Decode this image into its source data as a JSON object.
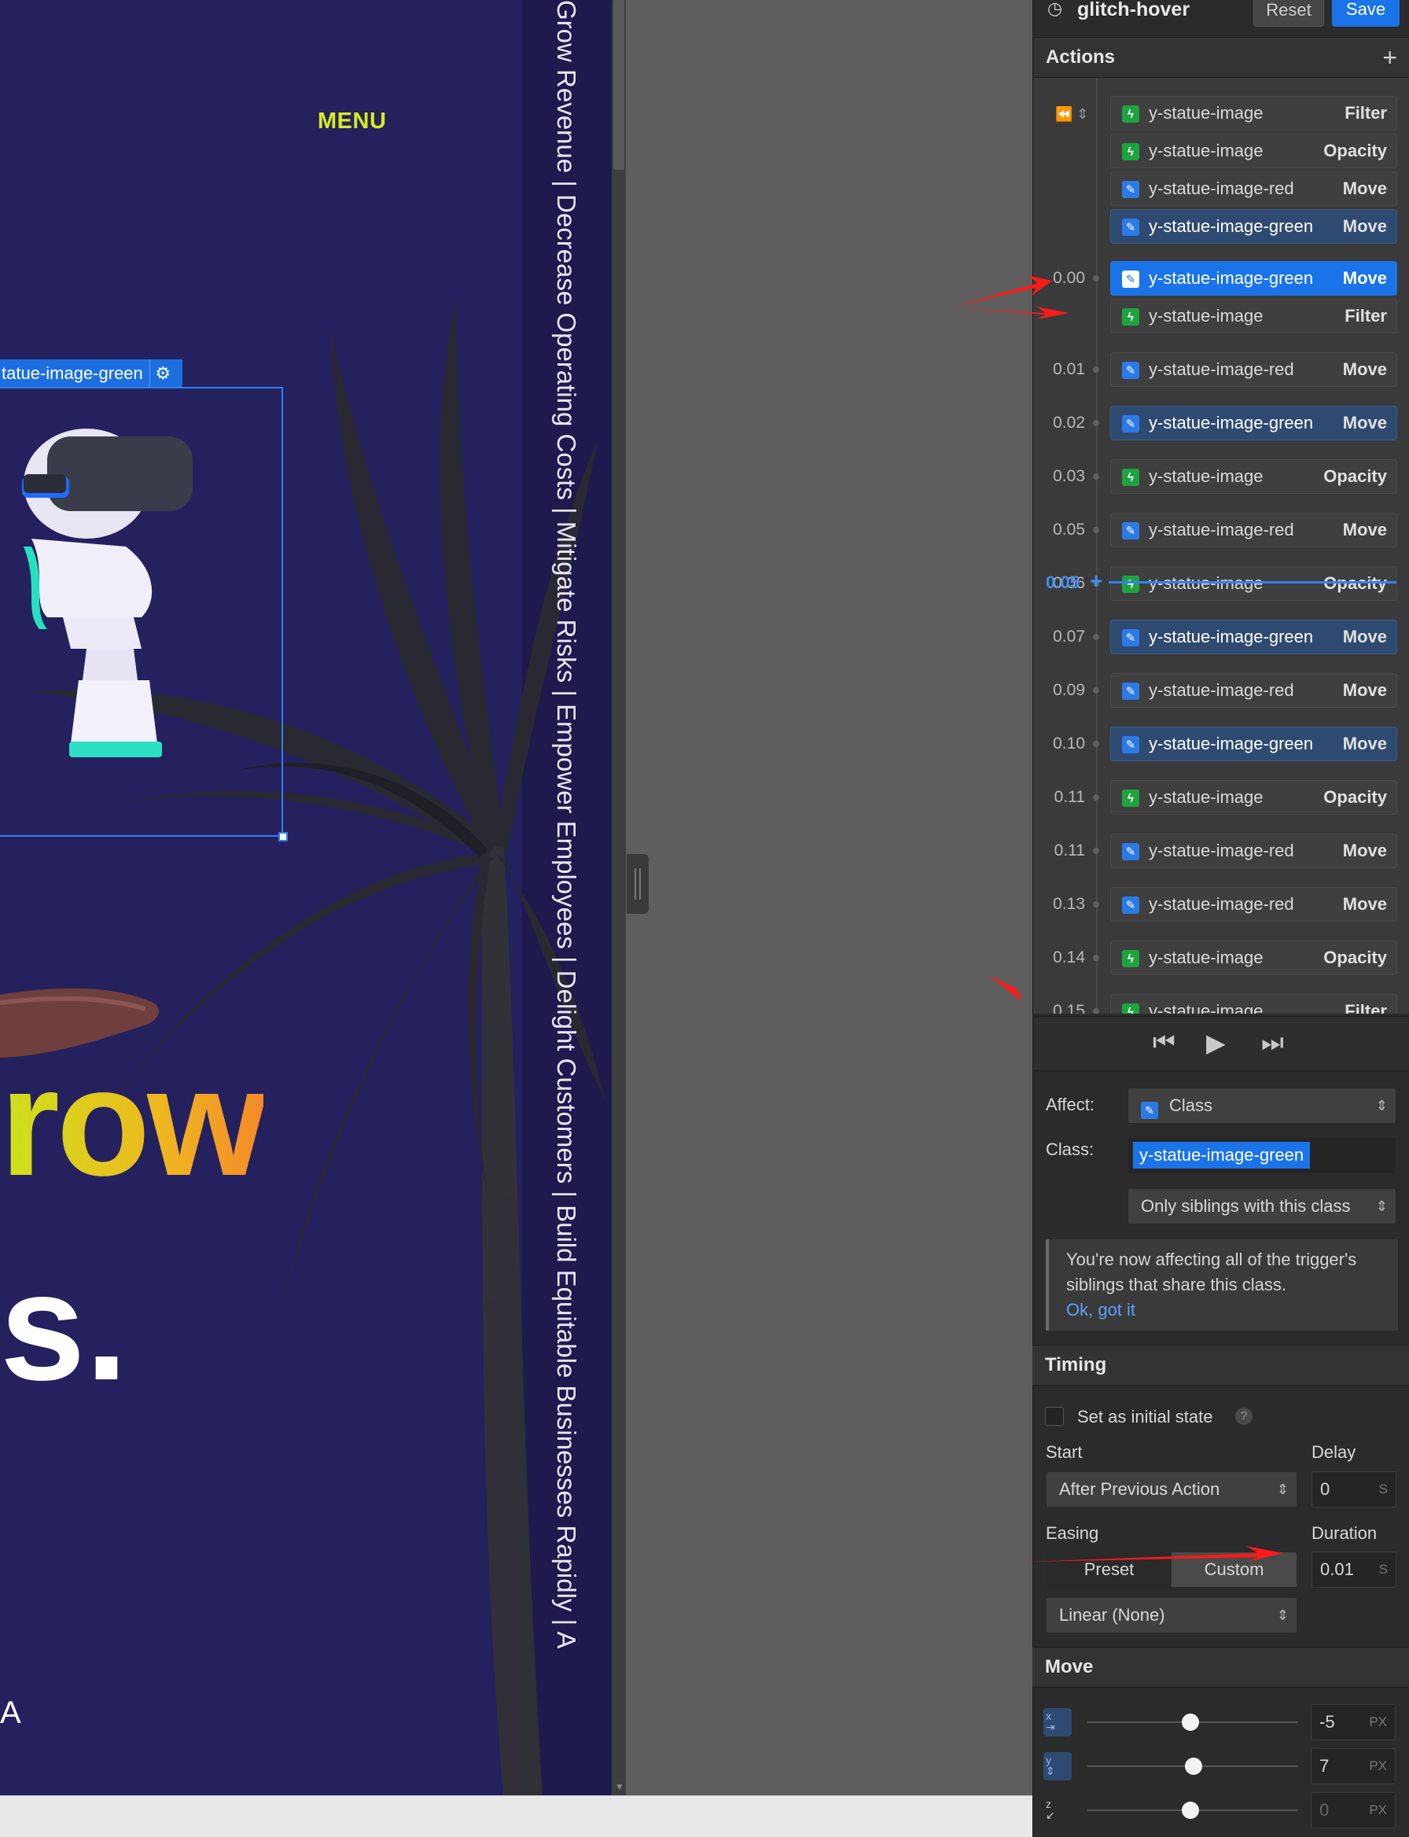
{
  "canvas": {
    "menu_label": "MENU",
    "vertical_text": "Grow Revenue  |  Decrease Operating Costs  |  Mitigate Risks  |  Empower Employees  |  Delight Customers  |  Build Equitable Businesses Rapidly  |  A",
    "selected_element_tag": "tatue-image-green",
    "headline_line1": "row",
    "headline_line2": "s.",
    "bottom_letter": "A"
  },
  "panel": {
    "interaction_name": "glitch-hover",
    "reset_label": "Reset",
    "save_label": "Save",
    "actions_title": "Actions",
    "playhead_time": "0.05",
    "actions": [
      {
        "time": "",
        "icon": "green",
        "target": "y-statue-image",
        "kind": "Filter"
      },
      {
        "time": "",
        "icon": "green",
        "target": "y-statue-image",
        "kind": "Opacity"
      },
      {
        "time": "",
        "icon": "blue",
        "target": "y-statue-image-red",
        "kind": "Move"
      },
      {
        "time": "",
        "icon": "blue",
        "target": "y-statue-image-green",
        "kind": "Move"
      },
      {
        "time": "0.00",
        "icon": "blue",
        "target": "y-statue-image-green",
        "kind": "Move"
      },
      {
        "time": "",
        "icon": "green",
        "target": "y-statue-image",
        "kind": "Filter"
      },
      {
        "time": "0.01",
        "icon": "blue",
        "target": "y-statue-image-red",
        "kind": "Move"
      },
      {
        "time": "0.02",
        "icon": "blue",
        "target": "y-statue-image-green",
        "kind": "Move"
      },
      {
        "time": "0.03",
        "icon": "green",
        "target": "y-statue-image",
        "kind": "Opacity"
      },
      {
        "time": "0.05",
        "icon": "blue",
        "target": "y-statue-image-red",
        "kind": "Move"
      },
      {
        "time": "0.06",
        "icon": "green",
        "target": "y-statue-image",
        "kind": "Opacity"
      },
      {
        "time": "0.07",
        "icon": "blue",
        "target": "y-statue-image-green",
        "kind": "Move"
      },
      {
        "time": "0.09",
        "icon": "blue",
        "target": "y-statue-image-red",
        "kind": "Move"
      },
      {
        "time": "0.10",
        "icon": "blue",
        "target": "y-statue-image-green",
        "kind": "Move"
      },
      {
        "time": "0.11",
        "icon": "green",
        "target": "y-statue-image",
        "kind": "Opacity"
      },
      {
        "time": "0.11",
        "icon": "blue",
        "target": "y-statue-image-red",
        "kind": "Move"
      },
      {
        "time": "0.13",
        "icon": "blue",
        "target": "y-statue-image-red",
        "kind": "Move"
      },
      {
        "time": "0.14",
        "icon": "green",
        "target": "y-statue-image",
        "kind": "Opacity"
      },
      {
        "time": "0.15",
        "icon": "green",
        "target": "y-statue-image",
        "kind": "Filter"
      }
    ],
    "affect_label": "Affect:",
    "affect_value": "Class",
    "class_label": "Class:",
    "class_value": "y-statue-image-green",
    "scope_value": "Only siblings with this class",
    "info_text": "You're now affecting all of the trigger's siblings that share this class.",
    "info_ok": "Ok, got it",
    "timing_title": "Timing",
    "initial_state_label": "Set as initial state",
    "start_label": "Start",
    "start_value": "After Previous Action",
    "delay_label": "Delay",
    "delay_value": "0",
    "delay_unit": "S",
    "easing_label": "Easing",
    "easing_preset": "Preset",
    "easing_custom": "Custom",
    "easing_value": "Linear (None)",
    "duration_label": "Duration",
    "duration_value": "0.01",
    "duration_unit": "S",
    "move_title": "Move",
    "move_x": "-5",
    "move_y": "7",
    "move_z": "0",
    "move_unit": "PX"
  }
}
